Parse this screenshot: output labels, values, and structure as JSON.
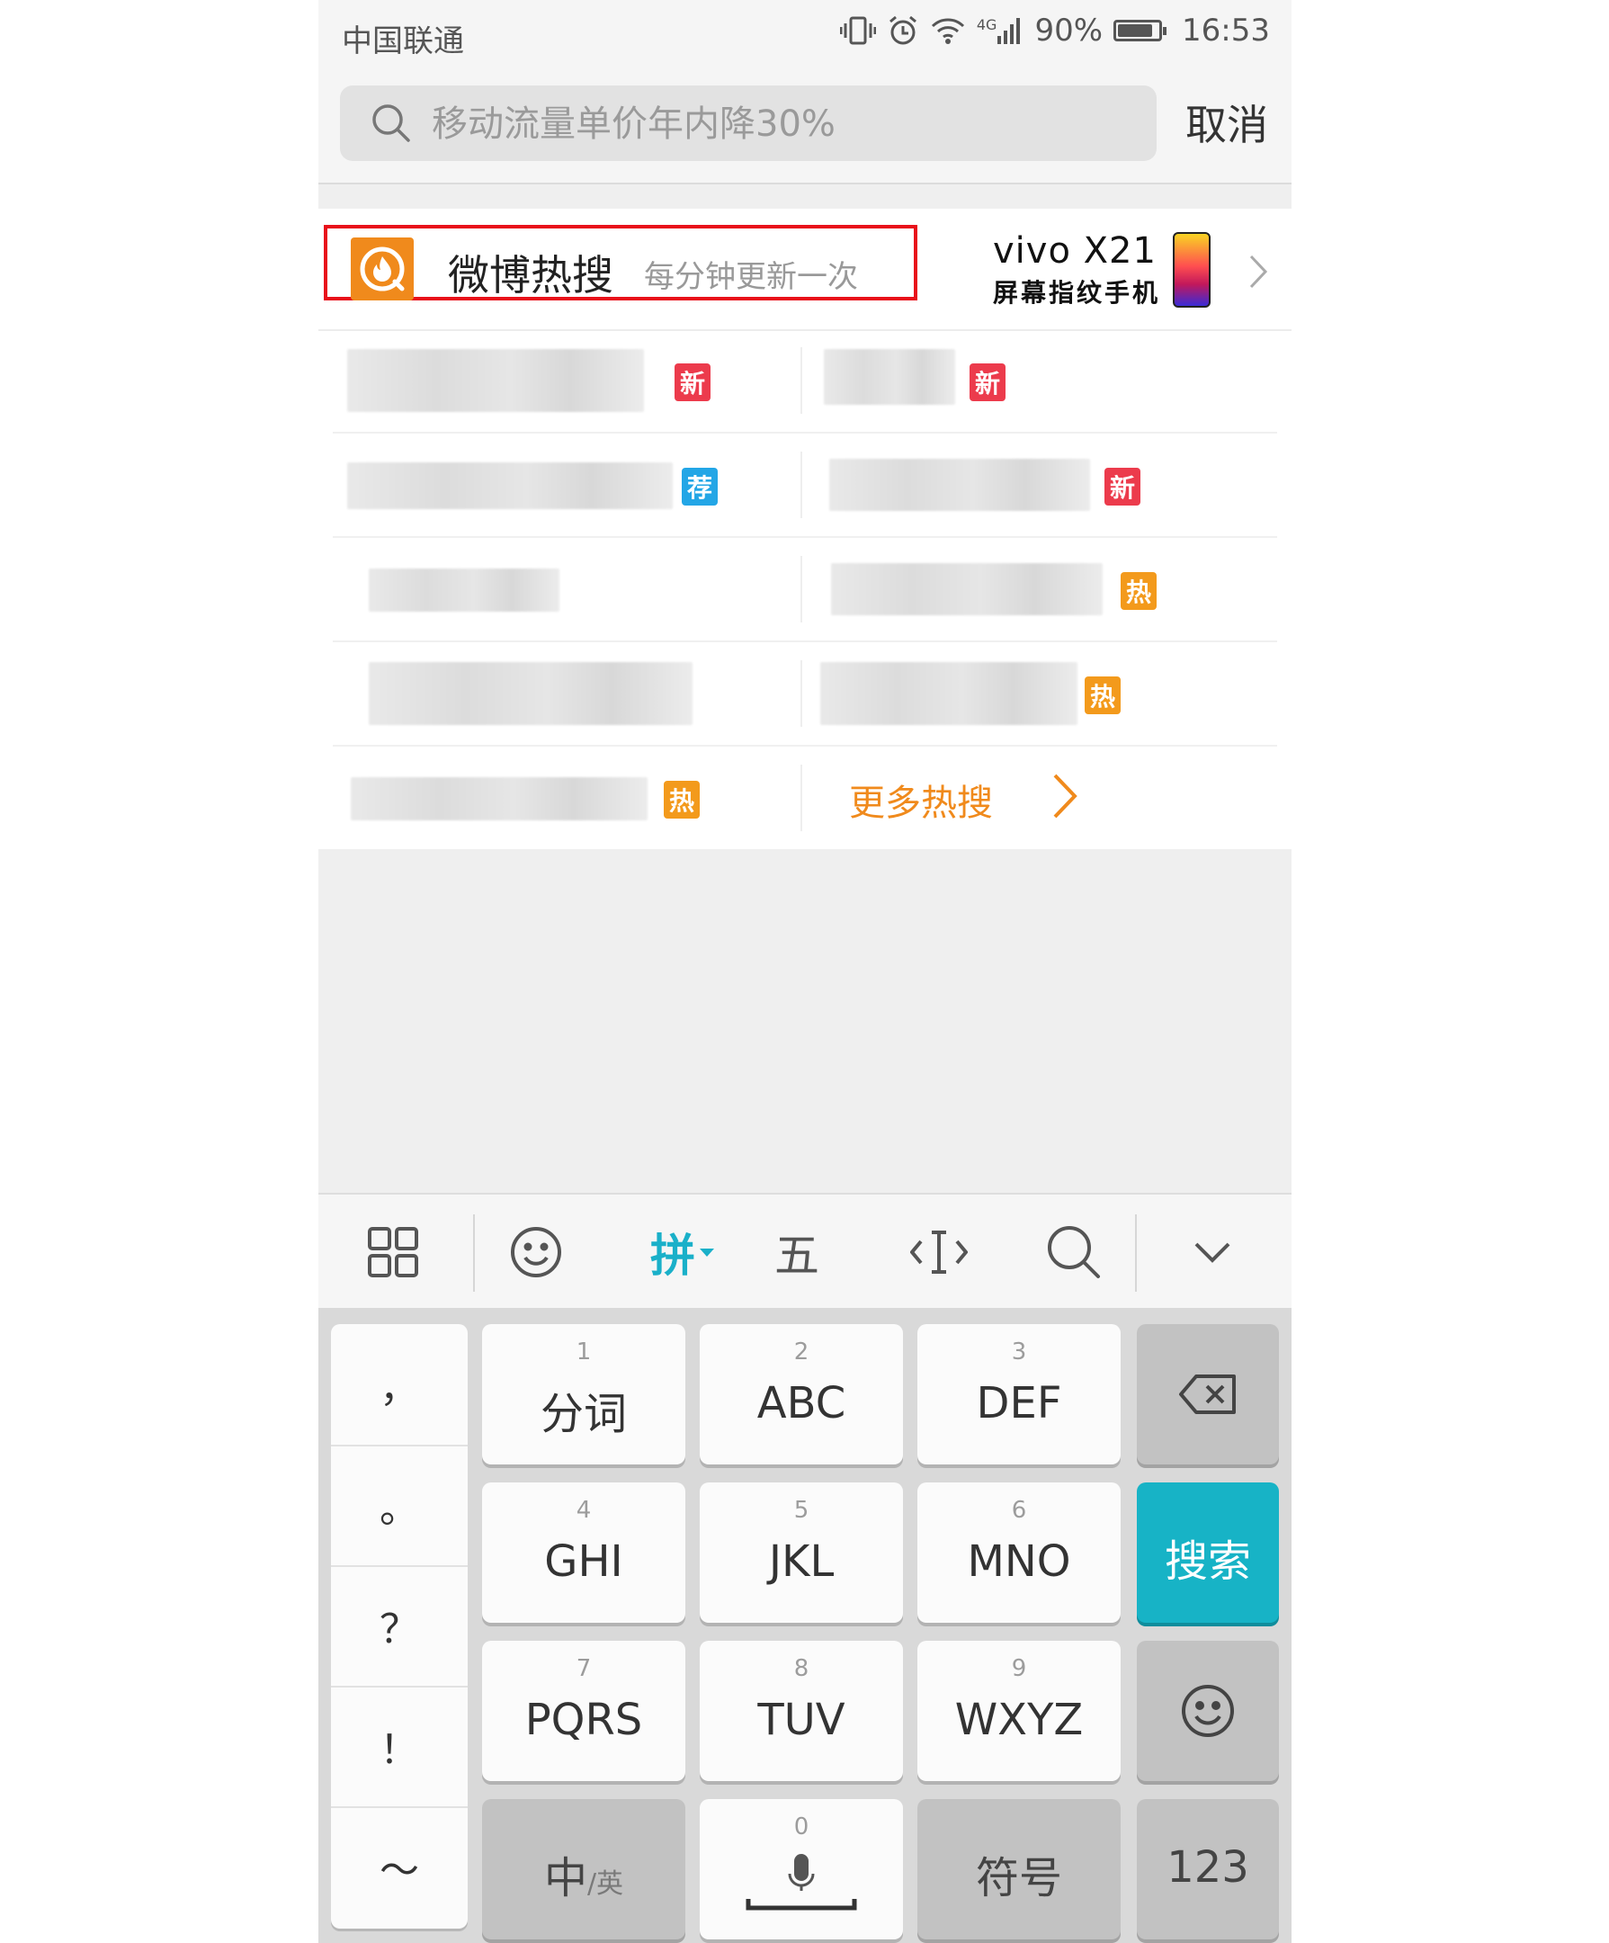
{
  "status_bar": {
    "carrier": "中国联通",
    "network": "4G",
    "battery": "90%",
    "battery_level": 0.9,
    "time": "16:53"
  },
  "search": {
    "placeholder": "移动流量单价年内降30%",
    "cancel_label": "取消"
  },
  "hot_search": {
    "title": "微博热搜",
    "subtitle": "每分钟更新一次",
    "ad": {
      "brand": "vivo X21",
      "slogan": "屏幕指纹手机"
    },
    "rows": [
      {
        "left": {
          "badge": "新",
          "badge_type": "new"
        },
        "right": {
          "badge": "新",
          "badge_type": "new"
        }
      },
      {
        "left": {
          "badge": "荐",
          "badge_type": "rec"
        },
        "right": {
          "badge": "新",
          "badge_type": "new"
        }
      },
      {
        "left": {
          "badge": "",
          "badge_type": ""
        },
        "right": {
          "badge": "热",
          "badge_type": "hot"
        }
      },
      {
        "left": {
          "badge": "",
          "badge_type": ""
        },
        "right": {
          "badge": "热",
          "badge_type": "hot"
        }
      },
      {
        "left": {
          "badge": "热",
          "badge_type": "hot"
        }
      }
    ],
    "more_label": "更多热搜"
  },
  "keyboard_toolbar": {
    "pinyin_label": "拼",
    "wubi_label": "五"
  },
  "keyboard": {
    "side_keys": [
      "，",
      "。",
      "？",
      "！",
      "～"
    ],
    "keys": [
      {
        "num": "1",
        "label": "分词"
      },
      {
        "num": "2",
        "label": "ABC"
      },
      {
        "num": "3",
        "label": "DEF"
      },
      {
        "num": "4",
        "label": "GHI"
      },
      {
        "num": "5",
        "label": "JKL"
      },
      {
        "num": "6",
        "label": "MNO"
      },
      {
        "num": "7",
        "label": "PQRS"
      },
      {
        "num": "8",
        "label": "TUV"
      },
      {
        "num": "9",
        "label": "WXYZ"
      }
    ],
    "search_key": "搜索",
    "lang_key_main": "中",
    "lang_key_sub": "/英",
    "space_num": "0",
    "symbol_key": "符号",
    "num_key": "123"
  },
  "colors": {
    "accent": "#17b3c6",
    "badge_new": "#ec3b4c",
    "badge_rec": "#23a6e6",
    "badge_hot": "#f39a1c",
    "more_link": "#f08a1c",
    "highlight_box": "#e8101a"
  },
  "icons": [
    "vibrate-icon",
    "alarm-icon",
    "wifi-icon",
    "signal-icon",
    "battery-icon",
    "search-icon",
    "fire-search-icon",
    "chevron-right-icon",
    "grid-icon",
    "emoji-icon",
    "cursor-icon",
    "search-icon",
    "chevron-down-icon",
    "backspace-icon",
    "microphone-icon"
  ]
}
